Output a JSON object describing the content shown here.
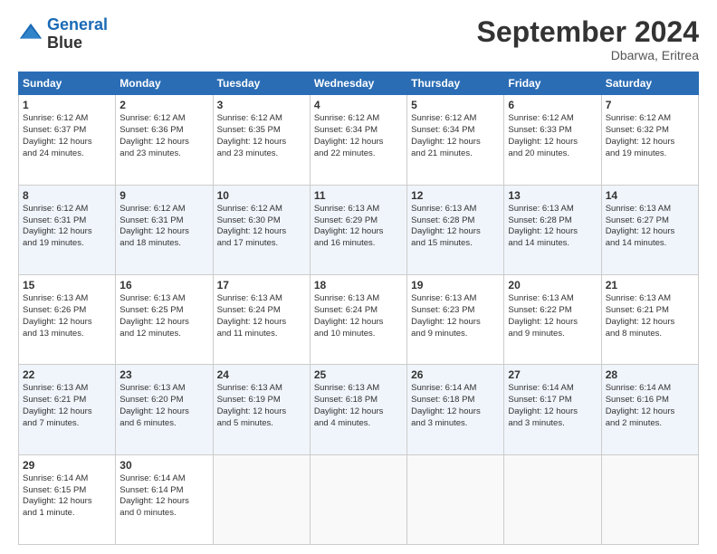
{
  "logo": {
    "line1": "General",
    "line2": "Blue"
  },
  "title": "September 2024",
  "subtitle": "Dbarwa, Eritrea",
  "weekdays": [
    "Sunday",
    "Monday",
    "Tuesday",
    "Wednesday",
    "Thursday",
    "Friday",
    "Saturday"
  ],
  "weeks": [
    [
      {
        "day": "1",
        "rise": "6:12 AM",
        "set": "6:37 PM",
        "daylight": "12 hours and 24 minutes."
      },
      {
        "day": "2",
        "rise": "6:12 AM",
        "set": "6:36 PM",
        "daylight": "12 hours and 23 minutes."
      },
      {
        "day": "3",
        "rise": "6:12 AM",
        "set": "6:35 PM",
        "daylight": "12 hours and 23 minutes."
      },
      {
        "day": "4",
        "rise": "6:12 AM",
        "set": "6:34 PM",
        "daylight": "12 hours and 22 minutes."
      },
      {
        "day": "5",
        "rise": "6:12 AM",
        "set": "6:34 PM",
        "daylight": "12 hours and 21 minutes."
      },
      {
        "day": "6",
        "rise": "6:12 AM",
        "set": "6:33 PM",
        "daylight": "12 hours and 20 minutes."
      },
      {
        "day": "7",
        "rise": "6:12 AM",
        "set": "6:32 PM",
        "daylight": "12 hours and 19 minutes."
      }
    ],
    [
      {
        "day": "8",
        "rise": "6:12 AM",
        "set": "6:31 PM",
        "daylight": "12 hours and 19 minutes."
      },
      {
        "day": "9",
        "rise": "6:12 AM",
        "set": "6:31 PM",
        "daylight": "12 hours and 18 minutes."
      },
      {
        "day": "10",
        "rise": "6:12 AM",
        "set": "6:30 PM",
        "daylight": "12 hours and 17 minutes."
      },
      {
        "day": "11",
        "rise": "6:13 AM",
        "set": "6:29 PM",
        "daylight": "12 hours and 16 minutes."
      },
      {
        "day": "12",
        "rise": "6:13 AM",
        "set": "6:28 PM",
        "daylight": "12 hours and 15 minutes."
      },
      {
        "day": "13",
        "rise": "6:13 AM",
        "set": "6:28 PM",
        "daylight": "12 hours and 14 minutes."
      },
      {
        "day": "14",
        "rise": "6:13 AM",
        "set": "6:27 PM",
        "daylight": "12 hours and 14 minutes."
      }
    ],
    [
      {
        "day": "15",
        "rise": "6:13 AM",
        "set": "6:26 PM",
        "daylight": "12 hours and 13 minutes."
      },
      {
        "day": "16",
        "rise": "6:13 AM",
        "set": "6:25 PM",
        "daylight": "12 hours and 12 minutes."
      },
      {
        "day": "17",
        "rise": "6:13 AM",
        "set": "6:24 PM",
        "daylight": "12 hours and 11 minutes."
      },
      {
        "day": "18",
        "rise": "6:13 AM",
        "set": "6:24 PM",
        "daylight": "12 hours and 10 minutes."
      },
      {
        "day": "19",
        "rise": "6:13 AM",
        "set": "6:23 PM",
        "daylight": "12 hours and 9 minutes."
      },
      {
        "day": "20",
        "rise": "6:13 AM",
        "set": "6:22 PM",
        "daylight": "12 hours and 9 minutes."
      },
      {
        "day": "21",
        "rise": "6:13 AM",
        "set": "6:21 PM",
        "daylight": "12 hours and 8 minutes."
      }
    ],
    [
      {
        "day": "22",
        "rise": "6:13 AM",
        "set": "6:21 PM",
        "daylight": "12 hours and 7 minutes."
      },
      {
        "day": "23",
        "rise": "6:13 AM",
        "set": "6:20 PM",
        "daylight": "12 hours and 6 minutes."
      },
      {
        "day": "24",
        "rise": "6:13 AM",
        "set": "6:19 PM",
        "daylight": "12 hours and 5 minutes."
      },
      {
        "day": "25",
        "rise": "6:13 AM",
        "set": "6:18 PM",
        "daylight": "12 hours and 4 minutes."
      },
      {
        "day": "26",
        "rise": "6:14 AM",
        "set": "6:18 PM",
        "daylight": "12 hours and 3 minutes."
      },
      {
        "day": "27",
        "rise": "6:14 AM",
        "set": "6:17 PM",
        "daylight": "12 hours and 3 minutes."
      },
      {
        "day": "28",
        "rise": "6:14 AM",
        "set": "6:16 PM",
        "daylight": "12 hours and 2 minutes."
      }
    ],
    [
      {
        "day": "29",
        "rise": "6:14 AM",
        "set": "6:15 PM",
        "daylight": "12 hours and 1 minute."
      },
      {
        "day": "30",
        "rise": "6:14 AM",
        "set": "6:14 PM",
        "daylight": "12 hours and 0 minutes."
      },
      null,
      null,
      null,
      null,
      null
    ]
  ]
}
